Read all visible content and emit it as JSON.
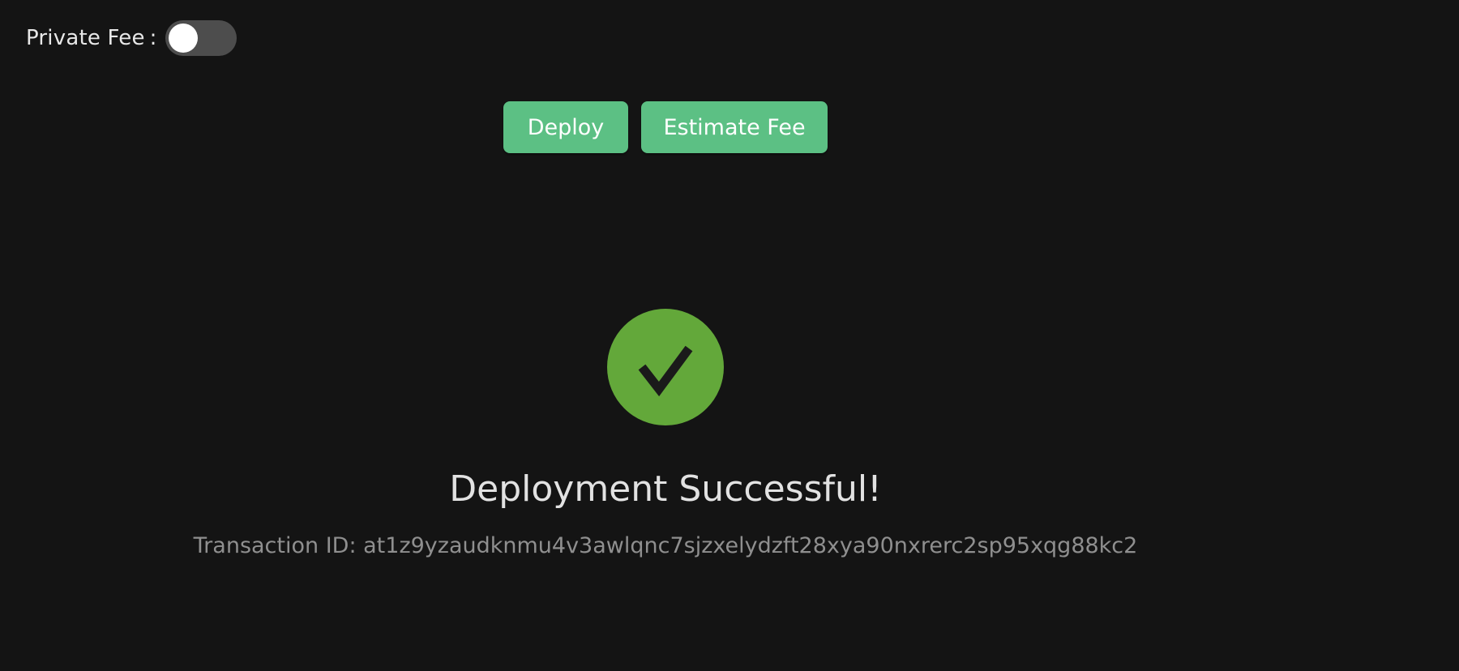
{
  "settings": {
    "private_fee_label": "Private Fee",
    "private_fee_colon": ":",
    "private_fee_enabled": false
  },
  "actions": {
    "deploy_label": "Deploy",
    "estimate_fee_label": "Estimate Fee"
  },
  "result": {
    "status_icon": "check-icon",
    "title": "Deployment Successful!",
    "transaction_id_text": "Transaction ID: at1z9yzaudknmu4v3awlqnc7sjzxelydzft28xya90nxrerc2sp95xqg88kc2"
  },
  "colors": {
    "background": "#141414",
    "button": "#5cc084",
    "success": "#63a83a",
    "toggle_off": "#4d4d4d"
  }
}
